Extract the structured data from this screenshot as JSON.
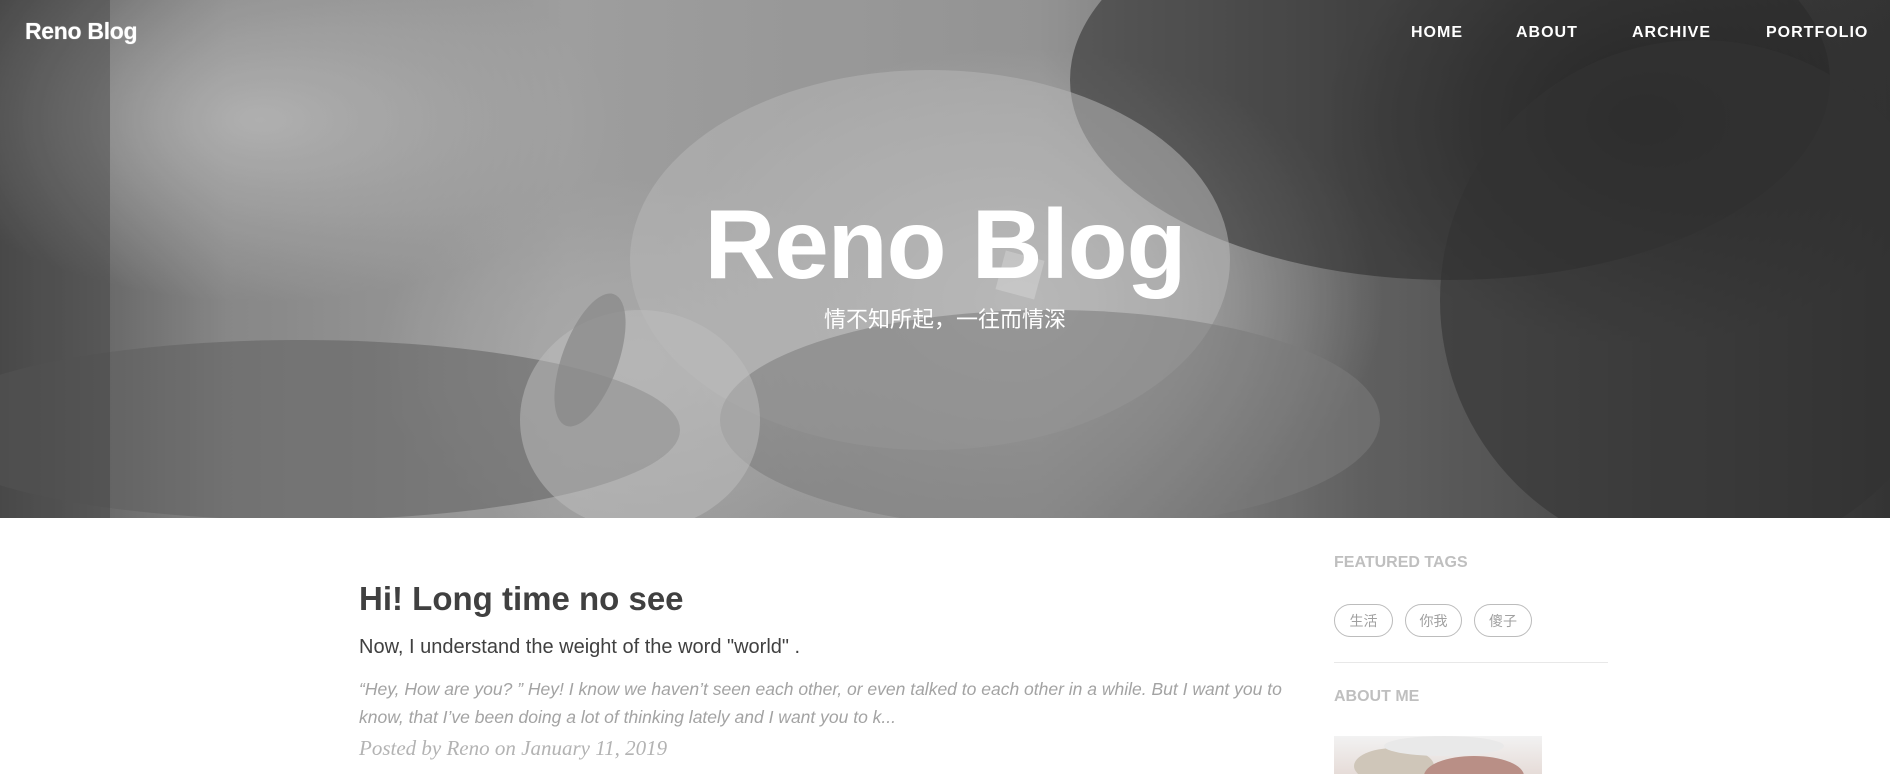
{
  "navbar": {
    "brand": "Reno Blog",
    "links": [
      "HOME",
      "ABOUT",
      "ARCHIVE",
      "PORTFOLIO"
    ]
  },
  "hero": {
    "title": "Reno Blog",
    "subtitle": "情不知所起，一往而情深"
  },
  "post": {
    "title": "Hi! Long time no see",
    "subtitle": "Now, I understand the weight of the word \"world\" .",
    "excerpt": "“Hey, How are you? ” Hey! I know we haven’t seen each other, or even talked to each other in a while. But I want you to know, that I’ve been doing a lot of thinking lately and I want you to k...",
    "meta": "Posted by Reno on January 11, 2019"
  },
  "sidebar": {
    "featured_tags_heading": "FEATURED TAGS",
    "tags": [
      "生活",
      "你我",
      "傻子"
    ],
    "about_heading": "ABOUT ME"
  },
  "colors": {
    "text_dark": "#404040",
    "text_muted": "#a3a3a3",
    "sidebar_heading": "#bfbfbf",
    "hero_text": "#ffffff"
  }
}
